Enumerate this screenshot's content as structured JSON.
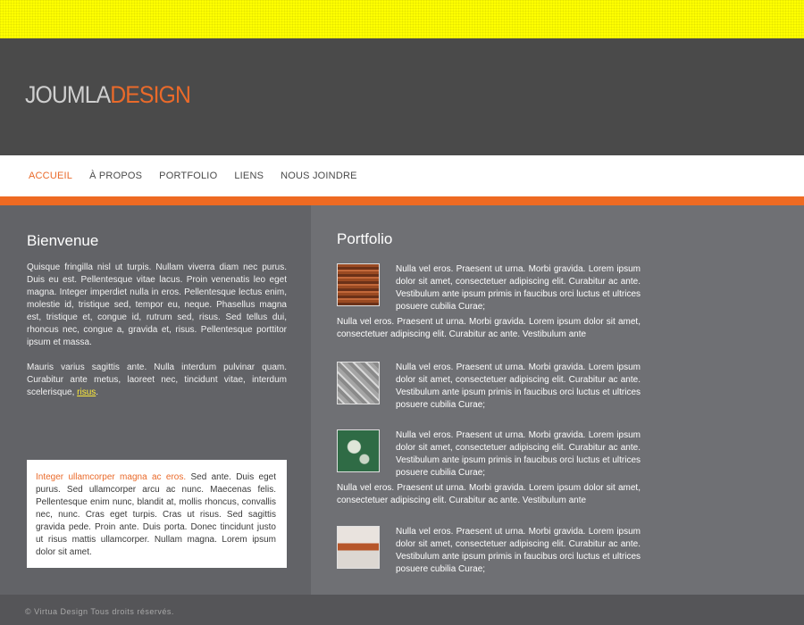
{
  "logo": {
    "part1": "JOUMLA",
    "part2": "DESIGN"
  },
  "nav": {
    "items": [
      "ACCUEIL",
      "À PROPOS",
      "PORTFOLIO",
      "LIENS",
      "NOUS JOINDRE"
    ]
  },
  "welcome": {
    "title": "Bienvenue",
    "para1": "Quisque fringilla nisl ut turpis. Nullam viverra diam nec purus. Duis eu est. Pellentesque vitae lacus. Proin venenatis leo eget magna. Integer imperdiet nulla in eros. Pellentesque lectus enim, molestie id, tristique sed, tempor eu, neque. Phasellus magna est, tristique et, congue id, rutrum sed, risus. Sed tellus dui, rhoncus nec, congue a, gravida et, risus. Pellentesque porttitor ipsum et massa.",
    "para2": "Mauris varius sagittis ante. Nulla interdum pulvinar quam. Curabitur ante metus, laoreet nec, tincidunt vitae, interdum scelerisque, ",
    "link": "risus",
    "para2_end": "."
  },
  "box": {
    "highlight": "Integer ullamcorper magna ac eros.",
    "text": " Sed ante. Duis eget purus. Sed ullamcorper arcu ac nunc. Maecenas felis. Pellentesque enim nunc, blandit at, mollis rhoncus, convallis nec, nunc. Cras eget turpis. Cras ut risus. Sed sagittis gravida pede. Proin ante. Duis porta. Donec tincidunt justo ut risus mattis ullamcorper. Nullam magna. Lorem ipsum dolor sit amet."
  },
  "portfolio": {
    "title": "Portfolio",
    "items": [
      {
        "text": "Nulla vel eros. Praesent ut urna. Morbi gravida. Lorem ipsum dolor sit amet, consectetuer adipiscing elit. Curabitur ac ante. Vestibulum ante ipsum primis in faucibus orci luctus et ultrices posuere cubilia Curae;",
        "extra": "Nulla vel eros. Praesent ut urna. Morbi gravida. Lorem ipsum dolor sit amet, consectetuer adipiscing elit. Curabitur ac ante. Vestibulum ante"
      },
      {
        "text": "Nulla vel eros. Praesent ut urna. Morbi gravida. Lorem ipsum dolor sit amet, consectetuer adipiscing elit. Curabitur ac ante. Vestibulum ante ipsum primis in faucibus orci luctus et ultrices posuere cubilia Curae;",
        "extra": ""
      },
      {
        "text": "Nulla vel eros. Praesent ut urna. Morbi gravida. Lorem ipsum dolor sit amet, consectetuer adipiscing elit. Curabitur ac ante. Vestibulum ante ipsum primis in faucibus orci luctus et ultrices posuere cubilia Curae;",
        "extra": "Nulla vel eros. Praesent ut urna. Morbi gravida. Lorem ipsum dolor sit amet, consectetuer adipiscing elit. Curabitur ac ante. Vestibulum ante"
      },
      {
        "text": "Nulla vel eros. Praesent ut urna. Morbi gravida. Lorem ipsum dolor sit amet, consectetuer adipiscing elit. Curabitur ac ante. Vestibulum ante ipsum primis in faucibus orci luctus et ultrices posuere cubilia Curae;",
        "extra": ""
      }
    ]
  },
  "footer": {
    "copyright": "© Virtua Design Tous droits réservés."
  },
  "colors": {
    "accent": "#ee6a22",
    "top_bar": "#ffff00",
    "header": "#4a4a4a",
    "link": "#ffec3a"
  }
}
